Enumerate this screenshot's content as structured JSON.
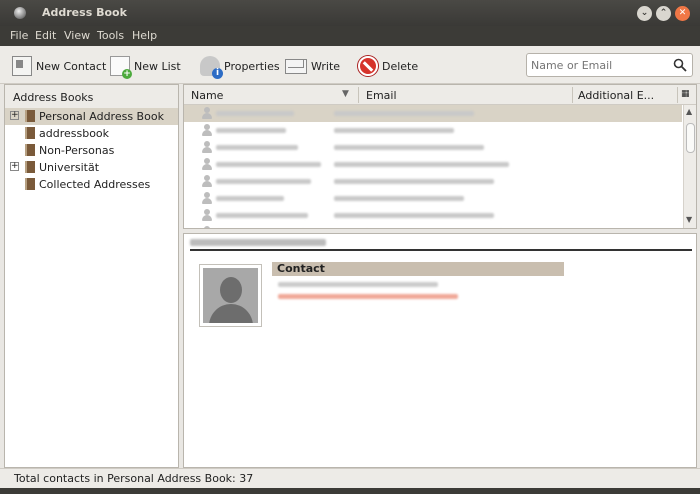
{
  "window": {
    "title": "Address Book"
  },
  "menu": {
    "items": [
      "File",
      "Edit",
      "View",
      "Tools",
      "Help"
    ]
  },
  "toolbar": {
    "new_contact": "New Contact",
    "new_list": "New List",
    "properties": "Properties",
    "write": "Write",
    "delete": "Delete"
  },
  "search": {
    "placeholder": "Name or Email"
  },
  "sidebar": {
    "header": "Address Books",
    "items": [
      {
        "label": "Personal Address Book",
        "expander": "+",
        "selected": true
      },
      {
        "label": "addressbook",
        "expander": ""
      },
      {
        "label": "Non-Personas",
        "expander": ""
      },
      {
        "label": "Universität",
        "expander": "+"
      },
      {
        "label": "Collected Addresses",
        "expander": ""
      }
    ]
  },
  "list": {
    "columns": [
      "Name",
      "Email",
      "Additional E..."
    ]
  },
  "card": {
    "section_header": "Contact"
  },
  "status": {
    "text": "Total contacts in Personal Address Book: 37"
  },
  "colors": {
    "titlebar": "#3c3b37",
    "close": "#f07746",
    "selection": "#d9d3c6"
  }
}
